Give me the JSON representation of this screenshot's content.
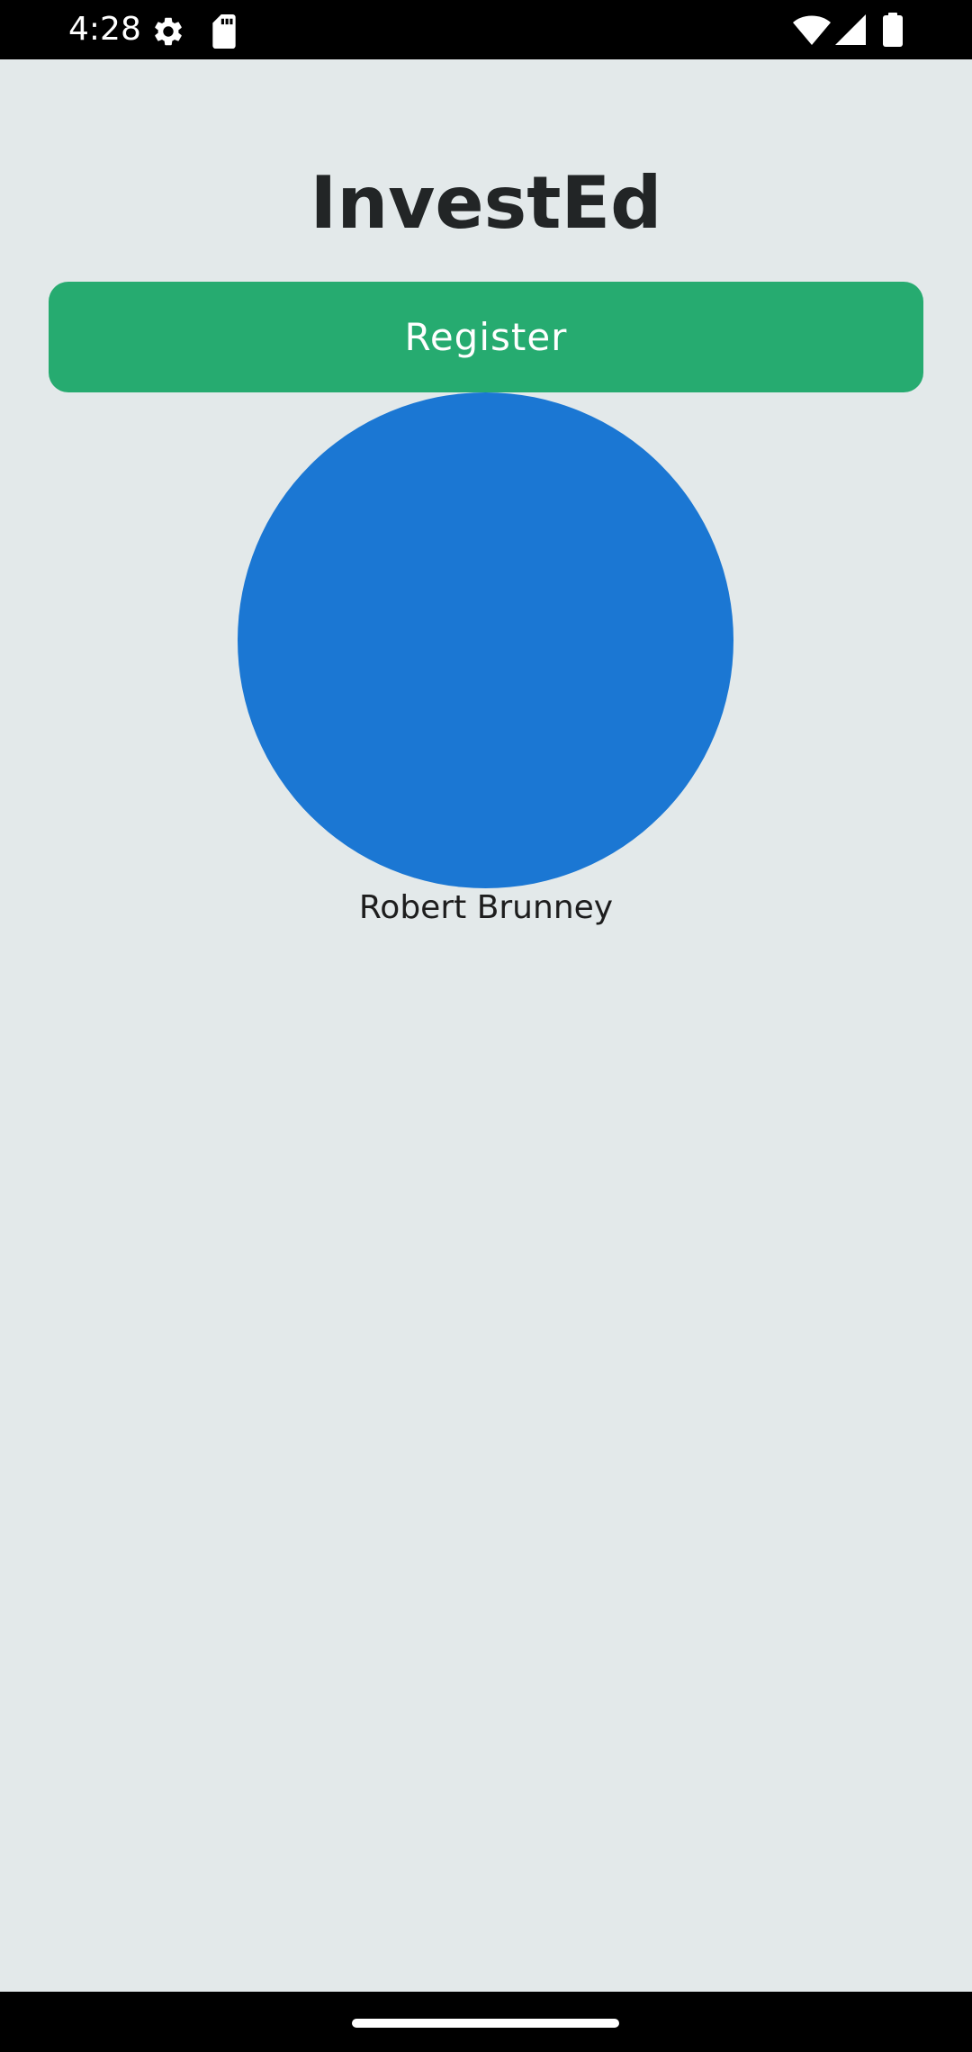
{
  "status_bar": {
    "time": "4:28",
    "icons": [
      "settings-icon",
      "sd-card-icon",
      "wifi-icon",
      "signal-icon",
      "battery-icon"
    ]
  },
  "app": {
    "title": "InvestEd"
  },
  "register": {
    "label": "Register"
  },
  "profile": {
    "name": "Robert Brunney",
    "avatar_color": "#1b77d3"
  },
  "colors": {
    "background": "#e3e9ea",
    "accent": "#26ab70",
    "title_text": "#222526"
  }
}
